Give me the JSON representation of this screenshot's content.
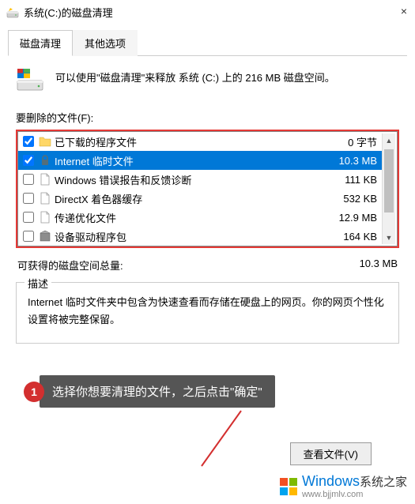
{
  "titlebar": {
    "title": "系统(C:)的磁盘清理"
  },
  "tabs": {
    "tab1": "磁盘清理",
    "tab2": "其他选项"
  },
  "intro": {
    "text": "可以使用\"磁盘清理\"来释放 系统 (C:) 上的 216 MB 磁盘空间。"
  },
  "list_label": "要删除的文件(F):",
  "files": [
    {
      "name": "已下载的程序文件",
      "size": "0 字节",
      "checked": true,
      "selected": false,
      "icon": "folder"
    },
    {
      "name": "Internet 临时文件",
      "size": "10.3 MB",
      "checked": true,
      "selected": true,
      "icon": "lock"
    },
    {
      "name": "Windows 错误报告和反馈诊断",
      "size": "111 KB",
      "checked": false,
      "selected": false,
      "icon": "file"
    },
    {
      "name": "DirectX 着色器缓存",
      "size": "532 KB",
      "checked": false,
      "selected": false,
      "icon": "file"
    },
    {
      "name": "传递优化文件",
      "size": "12.9 MB",
      "checked": false,
      "selected": false,
      "icon": "file"
    },
    {
      "name": "设备驱动程序包",
      "size": "164 KB",
      "checked": false,
      "selected": false,
      "icon": "package"
    }
  ],
  "total": {
    "label": "可获得的磁盘空间总量:",
    "value": "10.3 MB"
  },
  "description": {
    "label": "描述",
    "text": "Internet 临时文件夹中包含为快速查看而存储在硬盘上的网页。你的网页个性化设置将被完整保留。"
  },
  "annotation": {
    "number": "1",
    "text": "选择你想要清理的文件，之后点击\"确定\""
  },
  "view_files_btn": "查看文件(V)",
  "watermark": {
    "brand": "Windows",
    "sub": "系统之家",
    "url": "www.bjjmlv.com"
  }
}
